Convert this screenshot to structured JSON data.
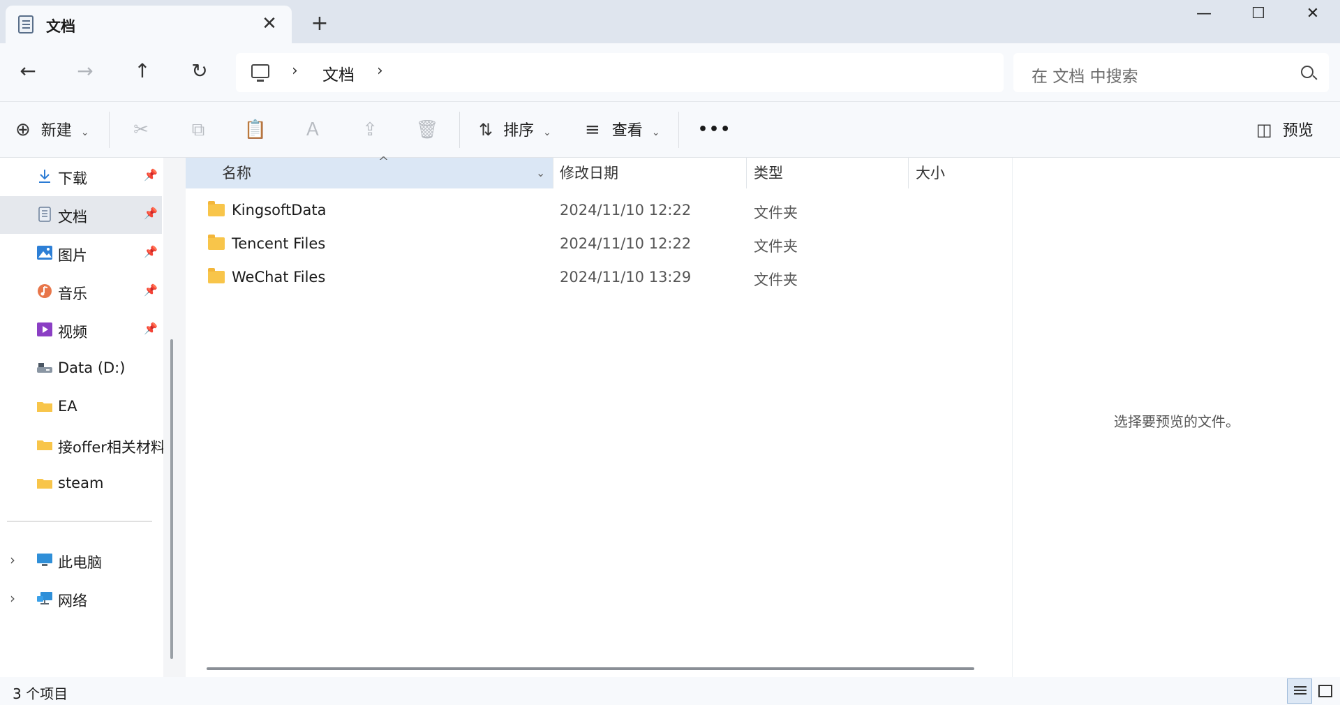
{
  "window": {
    "tab_title": "文档",
    "tab_close": "✕",
    "new_tab": "+",
    "minimize": "—",
    "maximize": "☐",
    "close": "✕"
  },
  "nav": {
    "back": "←",
    "forward": "→",
    "up": "↑",
    "refresh": "↻",
    "breadcrumb_sep": "›",
    "breadcrumb": [
      "文档"
    ],
    "search_placeholder": "在 文档 中搜索"
  },
  "toolbar": {
    "new_label": "新建",
    "new_icon": "⊕",
    "cut_icon": "✂",
    "copy_icon": "⧉",
    "paste_icon": "📋",
    "rename_icon": "Ａ",
    "share_icon": "⇪",
    "delete_icon": "🗑",
    "sort_icon": "⇅",
    "sort_label": "排序",
    "view_icon": "≡",
    "view_label": "查看",
    "more": "•••",
    "preview_icon": "◫",
    "preview_label": "预览",
    "chevron": "⌄"
  },
  "sidebar": {
    "pin": "📌",
    "expander": "›",
    "items": [
      {
        "label": "下载",
        "icon": "download-icon",
        "pinned": true,
        "selected": false
      },
      {
        "label": "文档",
        "icon": "document-icon",
        "pinned": true,
        "selected": true
      },
      {
        "label": "图片",
        "icon": "pictures-icon",
        "pinned": true,
        "selected": false
      },
      {
        "label": "音乐",
        "icon": "music-icon",
        "pinned": true,
        "selected": false
      },
      {
        "label": "视频",
        "icon": "videos-icon",
        "pinned": true,
        "selected": false
      },
      {
        "label": "Data (D:)",
        "icon": "drive-icon",
        "pinned": false,
        "selected": false
      },
      {
        "label": "EA",
        "icon": "folder-icon",
        "pinned": false,
        "selected": false
      },
      {
        "label": "接offer相关材料",
        "icon": "folder-icon",
        "pinned": false,
        "selected": false
      },
      {
        "label": "steam",
        "icon": "folder-icon",
        "pinned": false,
        "selected": false
      }
    ],
    "tree": [
      {
        "label": "此电脑",
        "icon": "this-pc-icon"
      },
      {
        "label": "网络",
        "icon": "network-icon"
      }
    ]
  },
  "columns": {
    "name": "名称",
    "modified": "修改日期",
    "type": "类型",
    "size": "大小",
    "sort_indicator": "^",
    "dropdown": "⌄"
  },
  "files": [
    {
      "name": "KingsoftData",
      "modified": "2024/11/10 12:22",
      "type": "文件夹",
      "size": ""
    },
    {
      "name": "Tencent Files",
      "modified": "2024/11/10 12:22",
      "type": "文件夹",
      "size": ""
    },
    {
      "name": "WeChat Files",
      "modified": "2024/11/10 13:29",
      "type": "文件夹",
      "size": ""
    }
  ],
  "preview": {
    "empty_text": "选择要预览的文件。"
  },
  "status": {
    "item_count": "3 个项目"
  }
}
